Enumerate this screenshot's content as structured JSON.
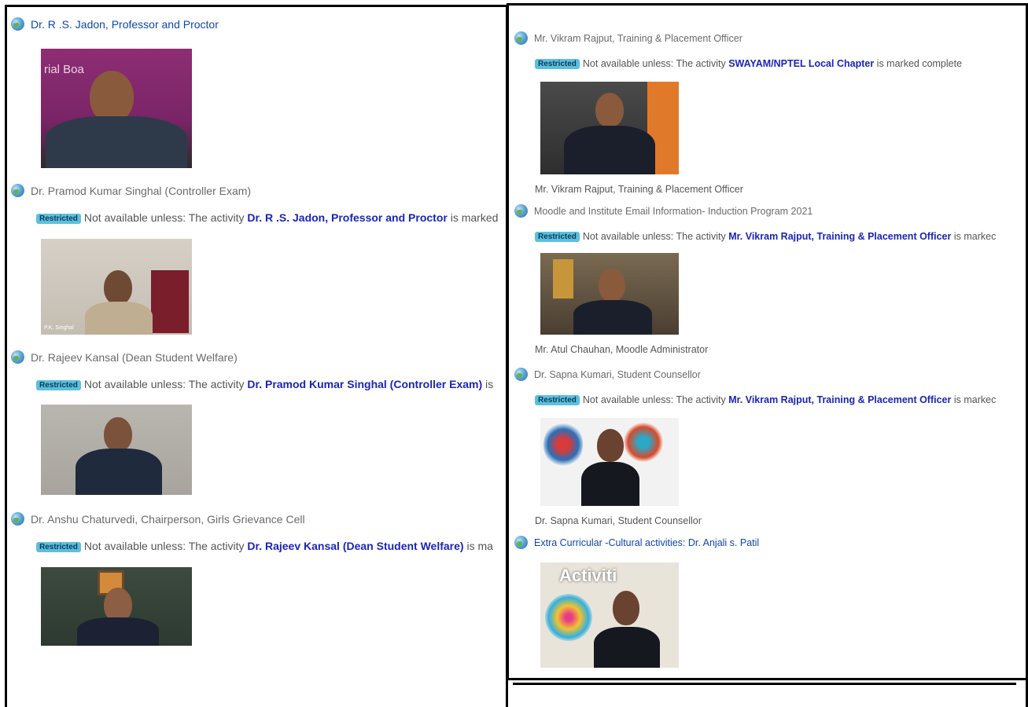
{
  "left": {
    "activities": [
      {
        "title": "Dr. R .S. Jadon, Professor and Proctor",
        "thumb_text": "rial Boa"
      },
      {
        "title": "Dr. Pramod Kumar Singhal (Controller Exam)",
        "restriction_prefix": "Not available unless: The activity ",
        "restriction_activity": "Dr. R .S. Jadon, Professor and Proctor",
        "restriction_suffix": " is marked",
        "thumb_text": "P.K. Singhal"
      },
      {
        "title": "Dr. Rajeev Kansal (Dean Student Welfare)",
        "restriction_prefix": "Not available unless: The activity ",
        "restriction_activity": "Dr. Pramod Kumar Singhal (Controller Exam)",
        "restriction_suffix": " is"
      },
      {
        "title": "Dr. Anshu Chaturvedi, Chairperson, Girls Grievance Cell",
        "restriction_prefix": "Not available unless: The activity ",
        "restriction_activity": "Dr. Rajeev Kansal (Dean Student Welfare)",
        "restriction_suffix": " is ma"
      }
    ]
  },
  "right": {
    "activities": [
      {
        "title": "Mr. Vikram Rajput, Training & Placement Officer",
        "restriction_prefix": "Not available unless: The activity ",
        "restriction_activity": "SWAYAM/NPTEL Local Chapter",
        "restriction_suffix": " is marked complete",
        "caption": "Mr. Vikram Rajput, Training & Placement Officer"
      },
      {
        "title": "Moodle and Institute Email Information- Induction Program 2021",
        "restriction_prefix": "Not available unless: The activity ",
        "restriction_activity": "Mr. Vikram Rajput, Training & Placement Officer",
        "restriction_suffix": " is markec",
        "caption": "Mr. Atul Chauhan, Moodle Administrator"
      },
      {
        "title": "Dr. Sapna Kumari, Student Counsellor",
        "restriction_prefix": "Not available unless: The activity ",
        "restriction_activity": "Mr. Vikram Rajput, Training & Placement Officer",
        "restriction_suffix": " is markec",
        "caption": "Dr. Sapna Kumari, Student Counsellor"
      },
      {
        "title": "Extra Curricular -Cultural activities: Dr. Anjali s. Patil",
        "thumb_text": "Activiti"
      }
    ]
  },
  "badge_label": "Restricted",
  "colors": {
    "badge": "#5bc0de",
    "link": "#0f47ad",
    "restriction_link": "#1a25b8"
  }
}
